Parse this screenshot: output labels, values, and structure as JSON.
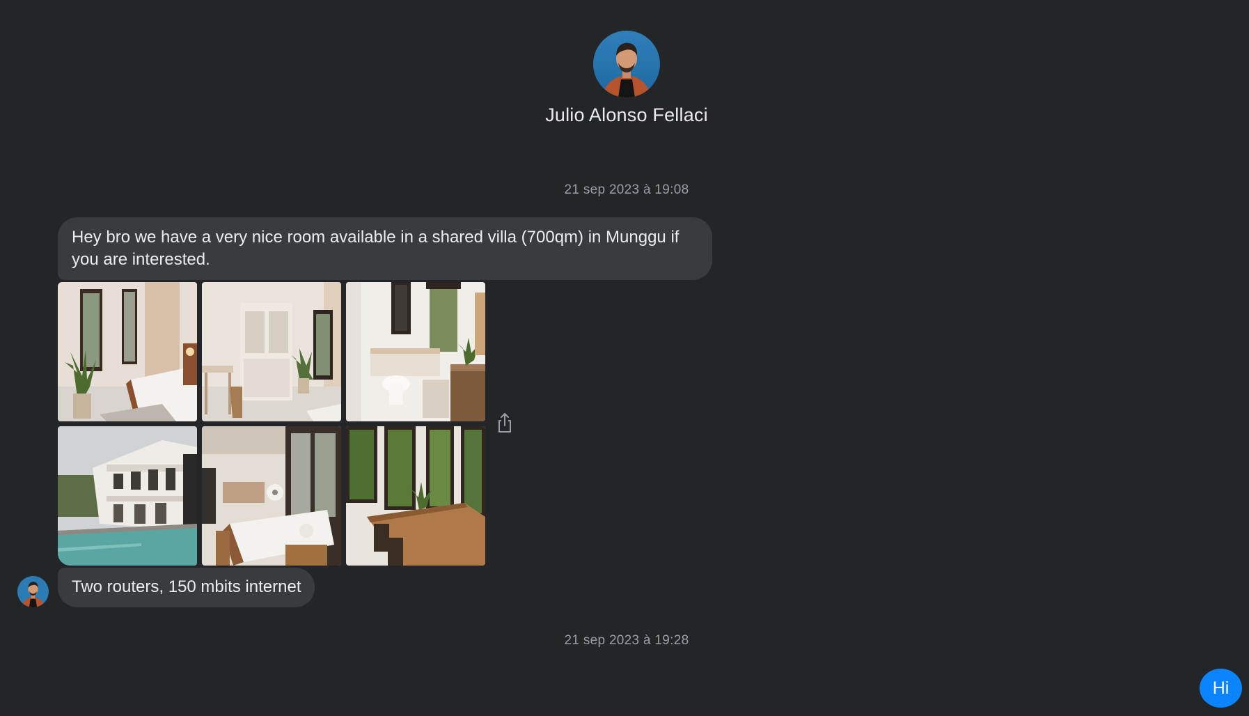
{
  "contact": {
    "name": "Julio Alonso Fellaci"
  },
  "conversation": {
    "timestamps": [
      "21 sep 2023 à 19:08",
      "21 sep 2023 à 19:28"
    ],
    "messages": [
      {
        "text": "Hey bro we have a very nice room available in a shared villa (700qm) in Munggu if you are interested."
      },
      {
        "text": "Two routers, 150 mbits internet"
      }
    ],
    "photos": [
      "bedroom",
      "wardrobe-room",
      "bathroom",
      "villa-pool",
      "living-room",
      "dining-room"
    ]
  },
  "actions": {
    "send_label": "Hi"
  },
  "colors": {
    "background": "#242528",
    "bubble": "#3a3b3f",
    "accent": "#0a84ff",
    "timestamp": "#9d9ea3"
  },
  "icons": {
    "share": "share-icon",
    "avatar": "avatar"
  }
}
